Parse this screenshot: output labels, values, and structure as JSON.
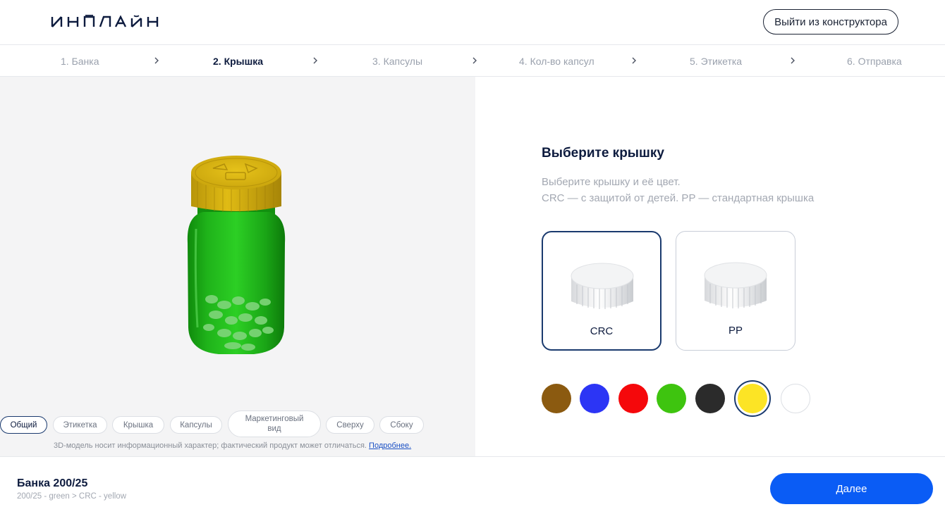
{
  "header": {
    "logo_text": "ИНПЛАЙН",
    "exit_label": "Выйти из конструктора"
  },
  "steps": [
    {
      "label": "1. Банка",
      "state": "done"
    },
    {
      "label": "2. Крышка",
      "state": "active"
    },
    {
      "label": "3. Капсулы",
      "state": "pending"
    },
    {
      "label": "4. Кол-во капсул",
      "state": "pending"
    },
    {
      "label": "5. Этикетка",
      "state": "pending"
    },
    {
      "label": "6. Отправка",
      "state": "pending"
    }
  ],
  "viewer": {
    "tabs": [
      {
        "label": "Общий",
        "active": true
      },
      {
        "label": "Этикетка",
        "active": false
      },
      {
        "label": "Крышка",
        "active": false
      },
      {
        "label": "Капсулы",
        "active": false
      },
      {
        "label": "Маркетинговый вид",
        "active": false
      },
      {
        "label": "Сверху",
        "active": false
      },
      {
        "label": "Сбоку",
        "active": false
      }
    ],
    "disclaimer": "3D-модель носит информационный характер; фактический продукт может отличаться.",
    "more_link": "Подробнее.",
    "jar_color": "#1fb31a",
    "cap_color": "#d4b00c"
  },
  "panel": {
    "title": "Выберите крышку",
    "desc_line1": "Выберите крышку и её цвет.",
    "desc_line2": "CRC — с защитой от детей. PP — стандартная крышка",
    "cap_options": [
      {
        "label": "CRC",
        "selected": true
      },
      {
        "label": "PP",
        "selected": false
      }
    ],
    "colors": [
      {
        "name": "brown",
        "hex": "#8b5a10",
        "selected": false
      },
      {
        "name": "blue",
        "hex": "#2c35f5",
        "selected": false
      },
      {
        "name": "red",
        "hex": "#f5080b",
        "selected": false
      },
      {
        "name": "green",
        "hex": "#3ec40f",
        "selected": false
      },
      {
        "name": "black",
        "hex": "#2b2b2b",
        "selected": false
      },
      {
        "name": "yellow",
        "hex": "#fce425",
        "selected": true
      },
      {
        "name": "white",
        "hex": "#ffffff",
        "selected": false
      }
    ]
  },
  "footer": {
    "product_name": "Банка 200/25",
    "summary": "200/25 - green > CRC - yellow",
    "next_label": "Далее"
  }
}
